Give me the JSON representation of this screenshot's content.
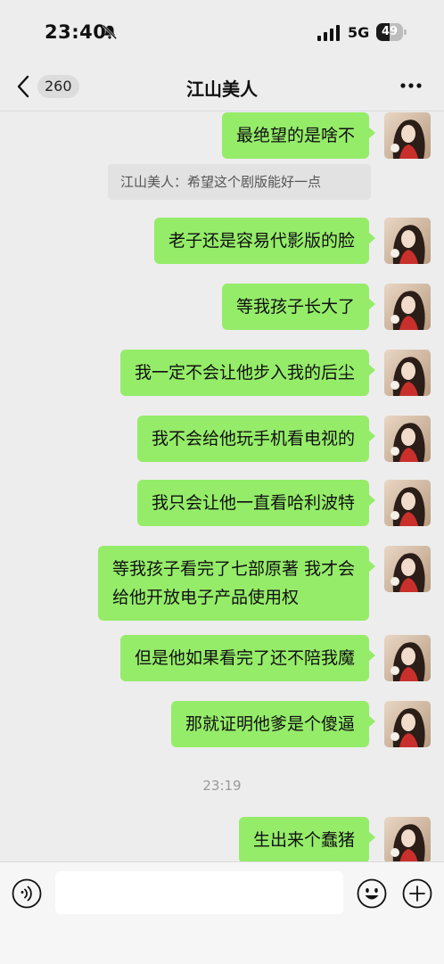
{
  "status_bar": {
    "time": "23:40",
    "network": "5G",
    "battery_level": "49",
    "icons": [
      "bell-slash-icon",
      "signal-icon",
      "battery-icon"
    ]
  },
  "header": {
    "unread_count": "260",
    "title": "江山美人",
    "icons": [
      "chevron-left-icon",
      "more-icon"
    ]
  },
  "messages": [
    {
      "text": "最绝望的是啥不"
    },
    {
      "quote": "江山美人：希望这个剧版能好一点"
    },
    {
      "text": "老子还是容易代影版的脸"
    },
    {
      "text": "等我孩子长大了"
    },
    {
      "text": "我一定不会让他步入我的后尘"
    },
    {
      "text": "我不会给他玩手机看电视的"
    },
    {
      "text": "我只会让他一直看哈利波特"
    },
    {
      "text": "等我孩子看完了七部原著 我才会\n给他开放电子产品使用权"
    },
    {
      "text": "但是他如果看完了还不陪我魔"
    },
    {
      "text": "那就证明他爹是个傻逼"
    },
    {
      "timestamp": "23:19"
    },
    {
      "text": "生出来个蠢猪"
    }
  ],
  "input": {
    "placeholder": "",
    "icons": [
      "voice-icon",
      "emoji-icon",
      "plus-icon"
    ]
  },
  "colors": {
    "bubble": "#95ec69",
    "background": "#ededed"
  }
}
